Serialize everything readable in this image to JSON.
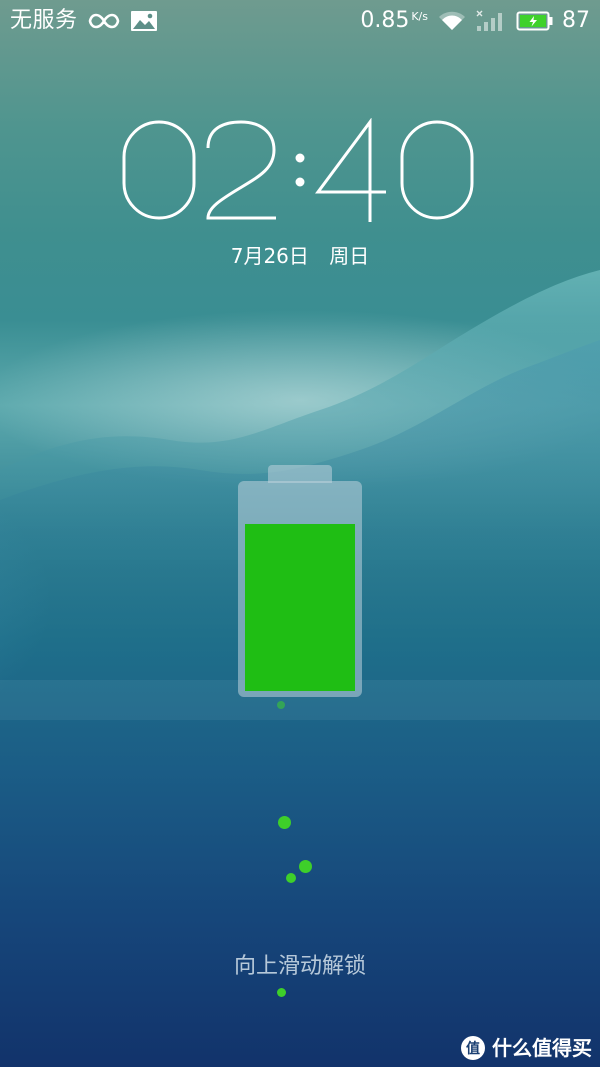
{
  "status_bar": {
    "carrier": "无服务",
    "infinity_icon": "infinity-icon",
    "gallery_icon": "image-icon",
    "net_speed": "0.85",
    "net_speed_unit": "K/s",
    "wifi_icon": "wifi-icon",
    "signal_icon": "signal-bars-icon",
    "battery_icon": "battery-charging-icon",
    "battery_percent": "87"
  },
  "lockscreen": {
    "time": "02:40",
    "date": "7月26日",
    "weekday": "周日",
    "charging_level": 87,
    "unlock_hint": "向上滑动解锁"
  },
  "watermark": {
    "text": "什么值得买",
    "icon": "smzdm-logo-icon"
  },
  "colors": {
    "charge_green": "#1fbe14",
    "bubble_green": "#3ecf2a",
    "text_white": "#ffffff"
  }
}
